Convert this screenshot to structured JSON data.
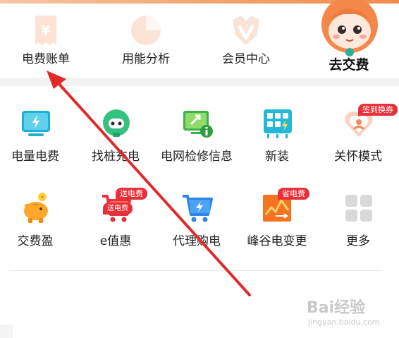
{
  "top_row": {
    "items": [
      {
        "label": "电费账单",
        "icon": "receipt-yen-icon"
      },
      {
        "label": "用能分析",
        "icon": "pie-chart-icon"
      },
      {
        "label": "会员中心",
        "icon": "vip-badge-icon"
      }
    ],
    "pay": {
      "label": "去交费",
      "icon": "mascot-icon"
    }
  },
  "grid": {
    "row1": [
      {
        "label": "电量电费",
        "icon": "power-bill-icon"
      },
      {
        "label": "找桩充电",
        "icon": "charging-pile-icon"
      },
      {
        "label": "电网检修信息",
        "icon": "grid-maintenance-icon"
      },
      {
        "label": "新装",
        "icon": "new-install-icon"
      },
      {
        "label": "关怀模式",
        "icon": "care-mode-icon",
        "badge": "签到换券"
      }
    ],
    "row2": [
      {
        "label": "交费盈",
        "icon": "piggy-bank-icon"
      },
      {
        "label": "e值惠",
        "icon": "shopping-cart-icon",
        "badge": "送电费"
      },
      {
        "label": "代理购电",
        "icon": "proxy-purchase-cart-icon"
      },
      {
        "label": "峰谷电变更",
        "icon": "peak-valley-chart-icon",
        "badge": "省电费"
      },
      {
        "label": "更多",
        "icon": "more-grid-icon"
      }
    ]
  },
  "watermark": {
    "main": "Bai经验",
    "sub": "jingyan.baidu.com"
  },
  "colors": {
    "accent_orange": "#f28a4d",
    "badge_red": "#e8303a",
    "annotation_red": "#e02a2a"
  }
}
